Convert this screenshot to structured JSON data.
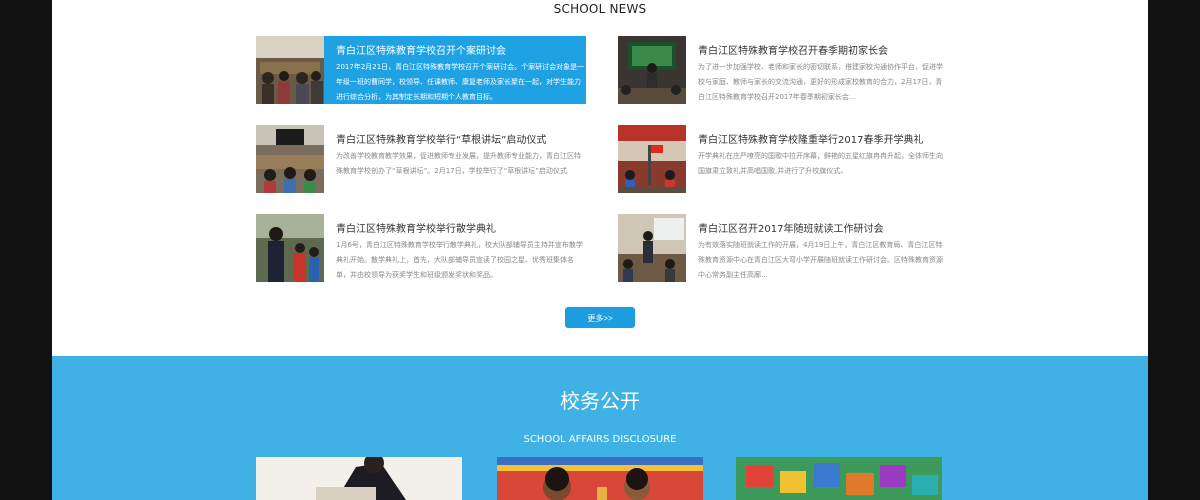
{
  "news": {
    "heading": "SCHOOL NEWS",
    "items": [
      {
        "title": "青白江区特殊教育学校召开个案研讨会",
        "desc": "2017年2月21日，青白江区特殊教育学校召开个案研讨会。个案研讨会对象是一年级一班的曹同学，校领导、任课教师、康复老师及家长聚在一起，对学生能力进行综合分析，为其制定长期和短期个人教育目标。",
        "active": true
      },
      {
        "title": "青白江区特殊教育学校召开春季期初家长会",
        "desc": "为了进一步加强学校、老师和家长的密切联系，搭建家校沟通协作平台，促进学校与家庭、教师与家长的交流沟通，更好的形成家校教育的合力，2月17日，青白江区特殊教育学校召开2017年春季期初家长会..."
      },
      {
        "title": "青白江区特殊教育学校举行“草根讲坛”启动仪式",
        "desc": "为改善学校教育教学效果，促进教师专业发展，提升教师专业能力，青白江区特殊教育学校创办了“草根讲坛”。2月17日，学校举行了“草根讲坛”启动仪式"
      },
      {
        "title": "青白江区特殊教育学校隆重举行2017春季开学典礼",
        "desc": "开学典礼在庄严嘹亮的国歌中拉开序幕，鲜艳的五星红旗冉冉升起，全体师生向国旗肃立致礼并高唱国歌,并进行了升校旗仪式。"
      },
      {
        "title": "青白江区特殊教育学校举行散学典礼",
        "desc": "1月6号，青白江区特殊教育学校举行散学典礼，校大队部辅导员主持并宣布散学典礼开始。散学典礼上，首先，大队部辅导员宣读了校园之星、优秀班集体名单，并由校领导为获奖学生和班级颁发奖状和奖品。"
      },
      {
        "title": "青白江区召开2017年随班就读工作研讨会",
        "desc": "为有效落实随班就读工作的开展，4月19日上午，青白江区教育局、青白江区特殊教育资源中心在青白江区大弯小学开展随班就读工作研讨会。区特殊教育资源中心常务副主任高廓..."
      }
    ],
    "images": [
      "meeting-photo",
      "parents-meeting-photo",
      "lecture-photo",
      "opening-ceremony-photo",
      "graduation-ceremony-photo",
      "workshop-photo"
    ],
    "more_label": "更多>>"
  },
  "affairs": {
    "title": "校务公开",
    "subtitle": "SCHOOL AFFAIRS DISCLOSURE",
    "cards": [
      {
        "image": "teacher-student-photo"
      },
      {
        "image": "children-photo"
      },
      {
        "image": "alphabet-blocks-photo"
      }
    ]
  },
  "colors": {
    "accent": "#1ea2e4",
    "band": "#3fb1e5"
  }
}
